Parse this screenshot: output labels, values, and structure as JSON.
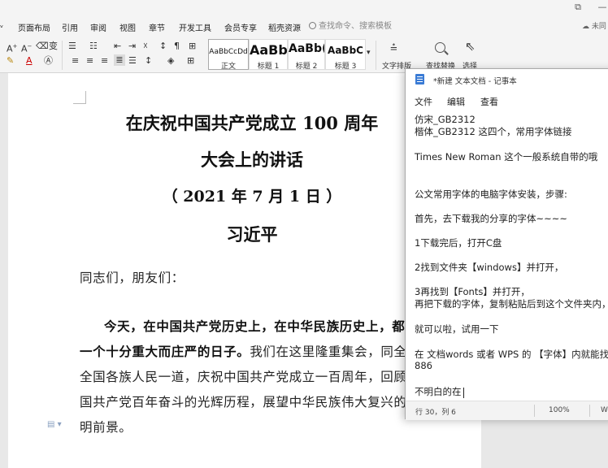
{
  "wps": {
    "menu": [
      "页面布局",
      "引用",
      "审阅",
      "视图",
      "章节",
      "开发工具",
      "会员专享",
      "稻壳资源"
    ],
    "search_placeholder": "查找命令、搜索模板",
    "cloud_label": "未同",
    "ribbon": {
      "font_row1": [
        "A⁺",
        "A⁻",
        "◇",
        "变",
        "·"
      ],
      "styles": [
        {
          "sample": "AaBbCcDd",
          "name": "正文"
        },
        {
          "sample": "AaBb",
          "name": "标题 1"
        },
        {
          "sample": "AaBb(",
          "name": "标题 2"
        },
        {
          "sample": "AaBbC",
          "name": "标题 3"
        }
      ],
      "text_layout_label": "文字排版",
      "find_replace_label": "查找替换",
      "select_label": "选择"
    },
    "document": {
      "title_line1": "在庆祝中国共产党成立 100 周年",
      "title_line2": "大会上的讲话",
      "date_line": "（ 2021 年 7 月 1 日 ）",
      "author": "习近平",
      "greeting": "同志们，朋友们：",
      "para1_bold_line1": "今天，在中国共产党历史上，在中华民族历史上，都是",
      "para1_bold_part2": "一个十分重大而庄严的日子。",
      "para1_rest_line2": "我们在这里隆重集会，同全党",
      "para1_line3": "全国各族人民一道，庆祝中国共产党成立一百周年，回顾中",
      "para1_line4": "国共产党百年奋斗的光辉历程，展望中华民族伟大复兴的光",
      "para1_line5": "明前景。"
    }
  },
  "notepad": {
    "title": "*新建 文本文档 - 记事本",
    "menu": [
      "文件",
      "编辑",
      "查看"
    ],
    "lines": [
      "仿宋_GB2312",
      "楷体_GB2312        这四个，常用字体链接 ",
      "Times New Roman   这个一般系统自带的哦",
      "公文常用字体的电脑字体安装，步骤:",
      "首先，去下载我的分享的字体~~~~",
      "1下载完后，打开C盘",
      "2找到文件夹【windows】并打开，",
      "3再找到【Fonts】并打开，",
      "再把下载的字体，复制粘贴后到这个文件夹内，",
      "就可以啦，试用一下",
      "在 文档words 或者 WPS 的 【字体】内就能找",
      "886",
      "不明白的在"
    ],
    "status": {
      "position": "行 30，列 6",
      "zoom": "100%",
      "extra": "W"
    }
  }
}
